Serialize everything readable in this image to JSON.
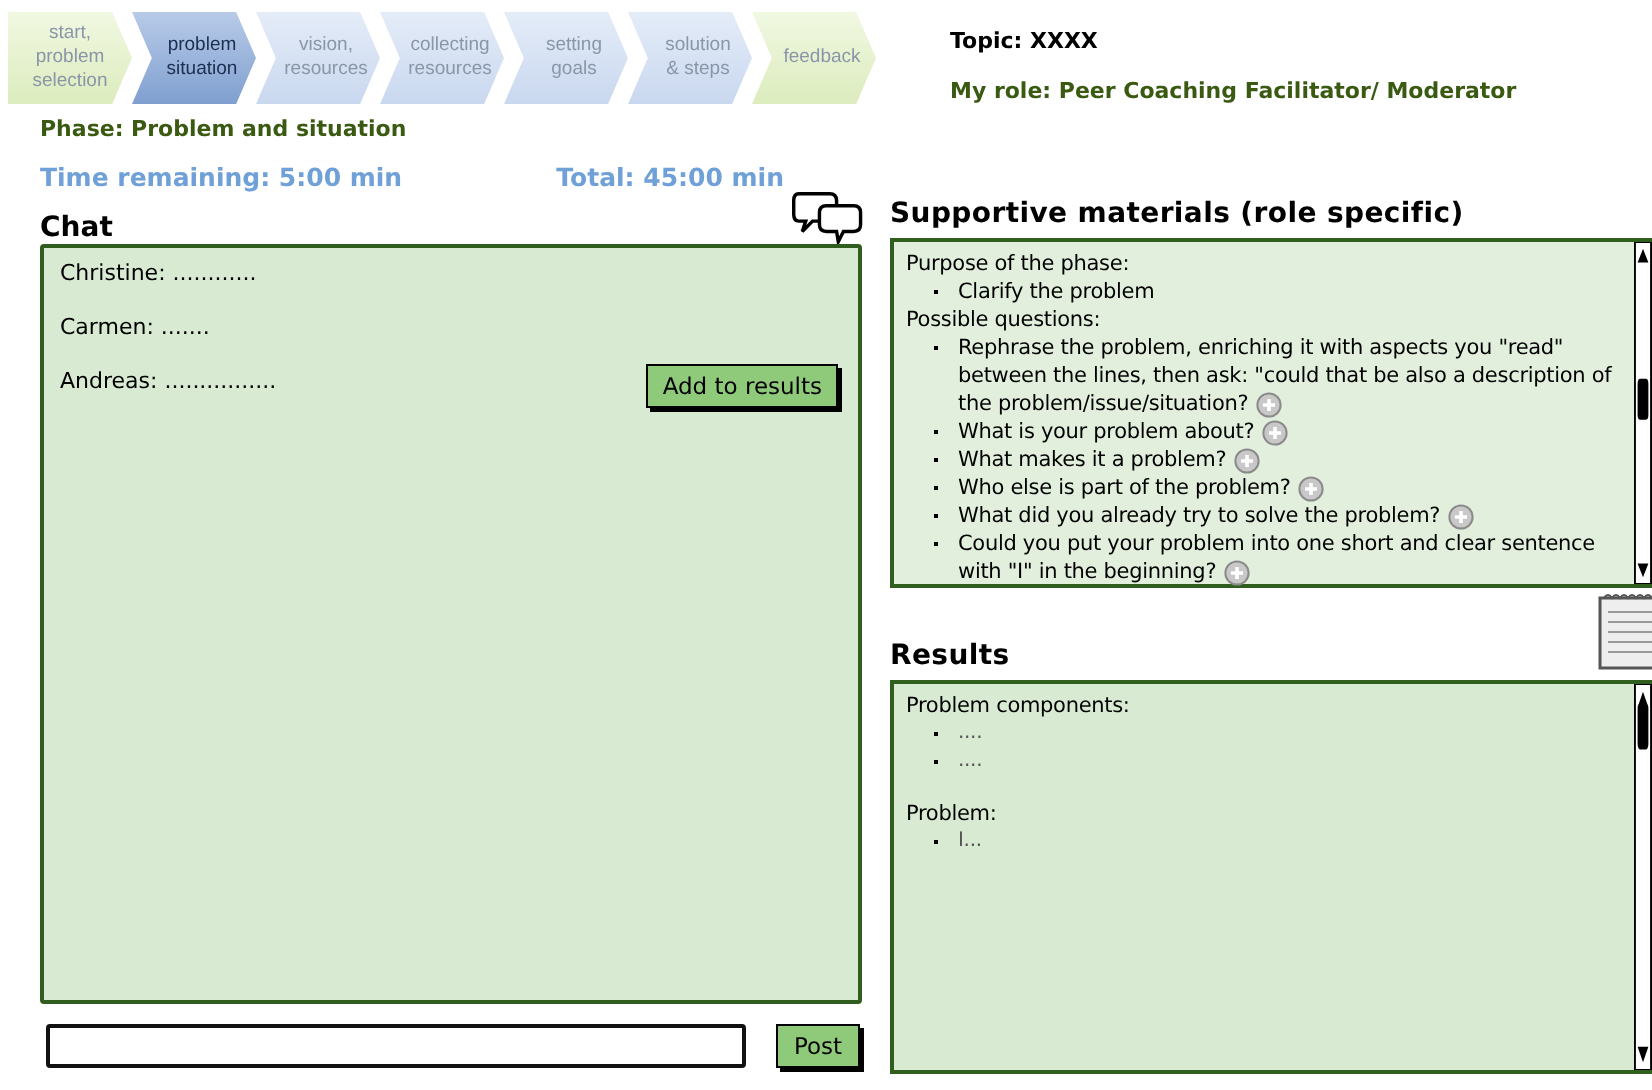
{
  "steps": [
    {
      "label": "start,\nproblem\nselection",
      "kind": "terminal",
      "selected": false
    },
    {
      "label": "problem\nsituation",
      "kind": "phase",
      "selected": true
    },
    {
      "label": "vision,\nresources",
      "kind": "phase",
      "selected": false
    },
    {
      "label": "collecting\nresources",
      "kind": "phase",
      "selected": false
    },
    {
      "label": "setting\ngoals",
      "kind": "phase",
      "selected": false
    },
    {
      "label": "solution\n& steps",
      "kind": "phase",
      "selected": false
    },
    {
      "label": "feedback",
      "kind": "terminal",
      "selected": false
    }
  ],
  "topic": "Topic: XXXX",
  "role": "My role: Peer Coaching Facilitator/ Moderator",
  "phase": "Phase: Problem and situation",
  "time_remaining": "Time remaining:  5:00 min",
  "total": "Total: 45:00 min",
  "chat": {
    "title": "Chat",
    "messages": [
      {
        "author": "Christine:",
        "text": "............"
      },
      {
        "author": "Carmen:",
        "text": "......."
      },
      {
        "author": "Andreas:",
        "text": "................"
      }
    ],
    "add_button": "Add to results",
    "post_button": "Post"
  },
  "materials": {
    "title": "Supportive materials (role specific)",
    "sections": [
      {
        "heading": "Purpose of the phase:",
        "items": [
          {
            "text": "Clarify the problem",
            "addable": false
          }
        ]
      },
      {
        "heading": "Possible questions:",
        "items": [
          {
            "text": "Rephrase the problem, enriching it with aspects you \"read\" between the lines, then ask: \"could that be also a description of the problem/issue/situation?",
            "addable": true
          },
          {
            "text": "What is your problem about?",
            "addable": true
          },
          {
            "text": "What makes it a problem?",
            "addable": true
          },
          {
            "text": "Who else is part of the problem?",
            "addable": true
          },
          {
            "text": "What did you already try to solve the problem?",
            "addable": true
          },
          {
            "text": "Could you put your problem into one short and clear sentence with \"I\" in the beginning?",
            "addable": true
          }
        ]
      }
    ]
  },
  "results": {
    "title": "Results",
    "sections": [
      {
        "heading": "Problem components:",
        "items": [
          {
            "text": "...."
          },
          {
            "text": "...."
          }
        ]
      },
      {
        "heading": "Problem:",
        "items": [
          {
            "text": "I..."
          }
        ]
      }
    ]
  }
}
